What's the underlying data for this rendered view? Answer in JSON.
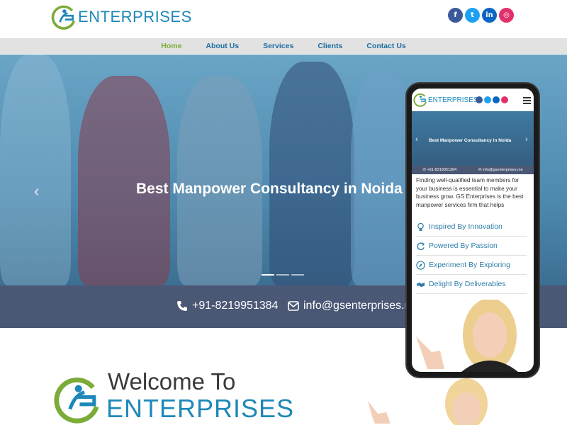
{
  "brand": {
    "name": "ENTERPRISES",
    "welcome_line": "Welcome To",
    "welcome_brand": "ENTERPRISES"
  },
  "socials": [
    {
      "name": "facebook",
      "glyph": "f",
      "color": "#3b5998"
    },
    {
      "name": "twitter",
      "glyph": "t",
      "color": "#1da1f2"
    },
    {
      "name": "linkedin",
      "glyph": "in",
      "color": "#0a66c2"
    },
    {
      "name": "instagram",
      "glyph": "◎",
      "color": "#e1306c"
    }
  ],
  "nav": {
    "items": [
      "Home",
      "About Us",
      "Services",
      "Clients",
      "Contact Us"
    ],
    "active": "Home"
  },
  "hero": {
    "title": "Best Manpower Consultancy in Noida",
    "prev_arrow": "‹"
  },
  "contact": {
    "phone": "+91-8219951384",
    "email": "info@gsenterprises.me"
  },
  "mobile": {
    "brand": "ENTERPRISES",
    "hero_title": "Best Manpower Consultancy in Noida",
    "phone": "+91-8219951384",
    "email": "info@gsenterprises.me",
    "paragraph": "Finding well-qualified team members for your business is essential to make your business grow. GS Enterprises is the best manpower services firm that helps",
    "features": [
      {
        "label": "Inspired By Innovation",
        "icon": "bulb-icon"
      },
      {
        "label": "Powered By Passion",
        "icon": "refresh-icon"
      },
      {
        "label": "Experiment By Exploring",
        "icon": "compass-icon"
      },
      {
        "label": "Delight By Deliverables",
        "icon": "handshake-icon"
      }
    ]
  },
  "colors": {
    "brand_blue": "#1e88b8",
    "brand_green": "#7bab38",
    "contact_bar": "#4a5775"
  }
}
